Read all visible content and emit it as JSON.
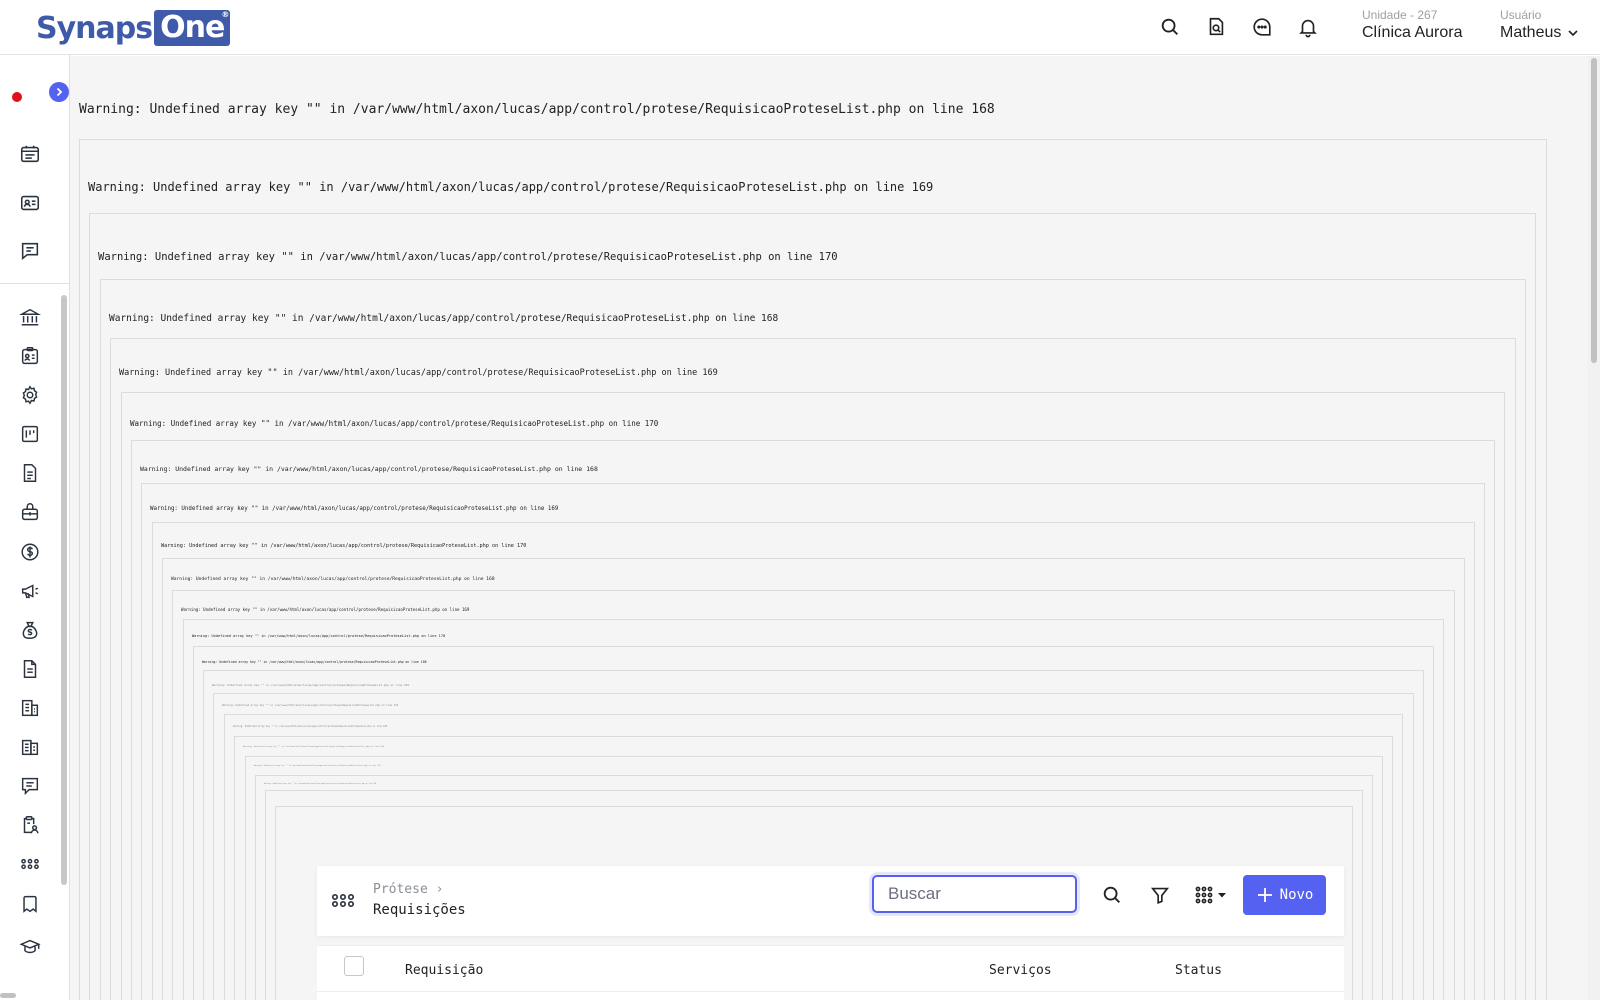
{
  "header": {
    "logo_left": "Synaps",
    "logo_right": "One",
    "logo_mark": "®",
    "unit_label": "Unidade - 267",
    "unit_name": "Clínica Aurora",
    "user_label": "Usuário",
    "user_name": "Matheus",
    "icons": [
      "search-icon",
      "document-search-icon",
      "chat-icon",
      "bell-icon",
      "chevron-down-icon"
    ]
  },
  "sidebar": {
    "icons": [
      "calendar-list-icon",
      "id-card-icon",
      "message-list-icon",
      "bank-icon",
      "clipboard-user-icon",
      "gear-icon",
      "kanban-icon",
      "document-icon",
      "medical-kit-icon",
      "dollar-icon",
      "megaphone-icon",
      "money-bag-icon",
      "file-list-icon",
      "building-icon",
      "buildings-icon",
      "comment-icon",
      "clipboard-person-icon",
      "apps-grid-icon",
      "tooth-icon",
      "graduation-cap-icon"
    ]
  },
  "warnings": [
    "Warning:  Undefined array key \"\" in /var/www/html/axon/lucas/app/control/protese/RequisicaoProteseList.php on line 168",
    "Warning:  Undefined array key \"\" in /var/www/html/axon/lucas/app/control/protese/RequisicaoProteseList.php on line 169",
    "Warning:  Undefined array key \"\" in /var/www/html/axon/lucas/app/control/protese/RequisicaoProteseList.php on line 170",
    "Warning:  Undefined array key \"\" in /var/www/html/axon/lucas/app/control/protese/RequisicaoProteseList.php on line 168",
    "Warning:  Undefined array key \"\" in /var/www/html/axon/lucas/app/control/protese/RequisicaoProteseList.php on line 169",
    "Warning:  Undefined array key \"\" in /var/www/html/axon/lucas/app/control/protese/RequisicaoProteseList.php on line 170",
    "Warning:  Undefined array key \"\" in /var/www/html/axon/lucas/app/control/protese/RequisicaoProteseList.php on line 168",
    "Warning:  Undefined array key \"\" in /var/www/html/axon/lucas/app/control/protese/RequisicaoProteseList.php on line 169",
    "Warning:  Undefined array key \"\" in /var/www/html/axon/lucas/app/control/protese/RequisicaoProteseList.php on line 170",
    "Warning:  Undefined array key \"\" in /var/www/html/axon/lucas/app/control/protese/RequisicaoProteseList.php on line 168",
    "Warning:  Undefined array key \"\" in /var/www/html/axon/lucas/app/control/protese/RequisicaoProteseList.php on line 169",
    "Warning:  Undefined array key \"\" in /var/www/html/axon/lucas/app/control/protese/RequisicaoProteseList.php on line 170",
    "Warning:  Undefined array key \"\" in /var/www/html/axon/lucas/app/control/protese/RequisicaoProteseList.php on line 168",
    "Warning:  Undefined array key \"\" in /var/www/html/axon/lucas/app/control/protese/RequisicaoProteseList.php on line 169",
    "Warning:  Undefined array key \"\" in /var/www/html/axon/lucas/app/control/protese/RequisicaoProteseList.php on line 170",
    "Warning:  Undefined array key \"\" in /var/www/html/axon/lucas/app/control/protese/RequisicaoProteseList.php on line 168",
    "Warning:  Undefined array key \"\" in /var/www/html/axon/lucas/app/control/protese/RequisicaoProteseList.php on line 169",
    "Warning:  Undefined array key \"\" in /var/www/html/axon/lucas/app/control/protese/RequisicaoProteseList.php on line 170",
    "Warning:  Undefined array key \"\" in /var/www/html/axon/lucas/app/control/protese/RequisicaoProteseList.php on line 168"
  ],
  "page": {
    "breadcrumb": "Prótese",
    "title": "Requisições",
    "search_placeholder": "Buscar",
    "new_button": "Novo"
  },
  "table": {
    "columns": [
      "Requisição",
      "Serviços",
      "Status"
    ]
  },
  "colors": {
    "accent": "#5561f0",
    "logo": "#3f5aa8",
    "record_dot": "#e0101a"
  }
}
